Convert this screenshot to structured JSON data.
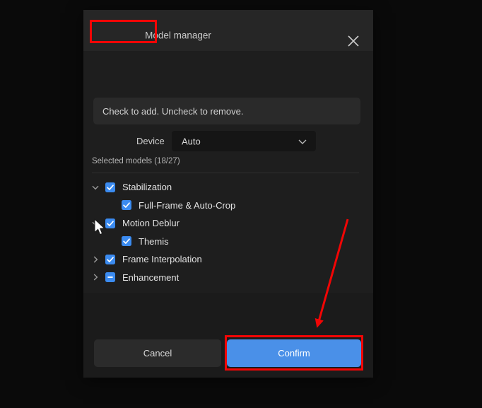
{
  "window": {
    "title": "Model manager",
    "close_icon": "close-icon"
  },
  "banner": {
    "text": "Check to add. Uncheck to remove."
  },
  "device": {
    "label": "Device",
    "value": "Auto",
    "chevron_icon": "chevron-down-icon"
  },
  "models": {
    "section_label": "Selected models (18/27)",
    "selected_count": 18,
    "total_count": 27,
    "items": [
      {
        "label": "Stabilization",
        "level": 0,
        "checkbox": "checked",
        "twisty": "expanded"
      },
      {
        "label": "Full-Frame & Auto-Crop",
        "level": 1,
        "checkbox": "checked",
        "twisty": "none"
      },
      {
        "label": "Motion Deblur",
        "level": 0,
        "checkbox": "checked",
        "twisty": "expanded"
      },
      {
        "label": "Themis",
        "level": 1,
        "checkbox": "checked",
        "twisty": "none"
      },
      {
        "label": "Frame Interpolation",
        "level": 0,
        "checkbox": "checked",
        "twisty": "collapsed"
      },
      {
        "label": "Enhancement",
        "level": 0,
        "checkbox": "indeterminate",
        "twisty": "collapsed"
      }
    ]
  },
  "footer": {
    "cancel_label": "Cancel",
    "confirm_label": "Confirm"
  },
  "colors": {
    "accent_blue": "#4a90e8",
    "checkbox_blue": "#3b8bf0",
    "annotation_red": "#f20505",
    "dialog_background": "#1e1e1e",
    "titlebar_background": "#262626",
    "page_background": "#0a0a0a"
  }
}
